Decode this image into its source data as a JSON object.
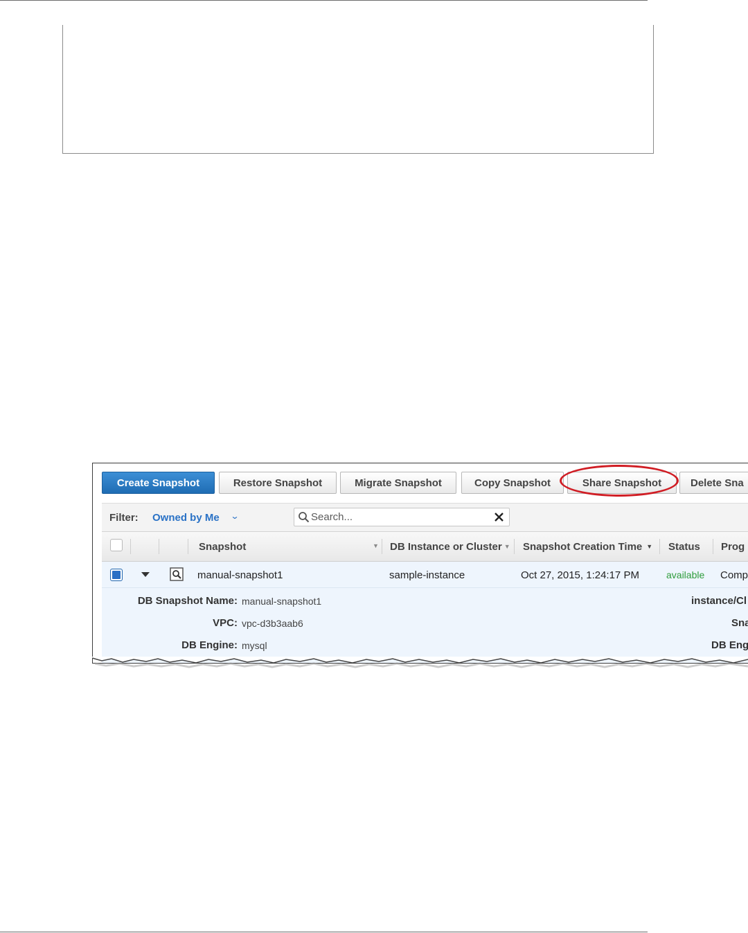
{
  "toolbar": {
    "create_label": "Create Snapshot",
    "restore_label": "Restore Snapshot",
    "migrate_label": "Migrate Snapshot",
    "copy_label": "Copy Snapshot",
    "share_label": "Share Snapshot",
    "delete_label": "Delete Sna"
  },
  "filter": {
    "label": "Filter:",
    "value": "Owned by Me"
  },
  "search": {
    "placeholder": "Search..."
  },
  "table": {
    "columns": [
      "Snapshot",
      "DB Instance or Cluster",
      "Snapshot Creation Time",
      "Status",
      "Prog"
    ],
    "rows": [
      {
        "snapshot": "manual-snapshot1",
        "db_instance": "sample-instance",
        "creation_time": "Oct 27, 2015, 1:24:17 PM",
        "status": "available",
        "progress": "Comp"
      }
    ]
  },
  "details": {
    "name_label": "DB Snapshot Name:",
    "name_value": "manual-snapshot1",
    "vpc_label": "VPC:",
    "vpc_value": "vpc-d3b3aab6",
    "engine_label": "DB Engine:",
    "engine_value": "mysql",
    "right_1": "instance/Cl",
    "right_2": "Sna",
    "right_3": "DB Eng"
  },
  "colors": {
    "primary_button": "#1f6cb3",
    "link_blue": "#2a72c6",
    "status_green": "#2e9c3a",
    "highlight_red": "#d01d24",
    "selected_row": "#eef5fd"
  }
}
